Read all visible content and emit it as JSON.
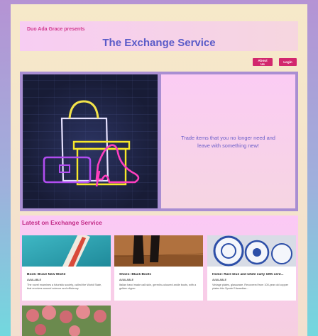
{
  "header": {
    "brand": "Duo Ada Grace presents",
    "title": "The Exchange Service"
  },
  "nav": {
    "about_label": "About Us",
    "login_label": "Login"
  },
  "hero": {
    "tagline": "Trade items that you no longer need and leave with something new!",
    "image_icon": "neon-shopping-bags-heel-illustration"
  },
  "latest": {
    "title": "Latest on Exchange Service",
    "items": [
      {
        "title": "Book: Brave New World",
        "status": "AVAILABLE",
        "description": "The novel examines a futuristic society, called the World State, that revolves around science and efficiency."
      },
      {
        "title": "Shoes: Black Boots",
        "status": "AVAILABLE",
        "description": "Italian hand made calf-skin, gremlin-coloured ankle boots, with a golden zipper"
      },
      {
        "title": "Home: Rare blue and white early 19th cent...",
        "status": "AVAILABLE",
        "description": "Vintage plates, glassware. Recovered from 100-year old copper plates this Spode Edwardian..."
      },
      {
        "title": "",
        "status": "",
        "description": ""
      }
    ]
  },
  "colors": {
    "accent_pink": "#d2286d",
    "title_blue": "#5a5bc8",
    "latest_title": "#c22a86"
  }
}
